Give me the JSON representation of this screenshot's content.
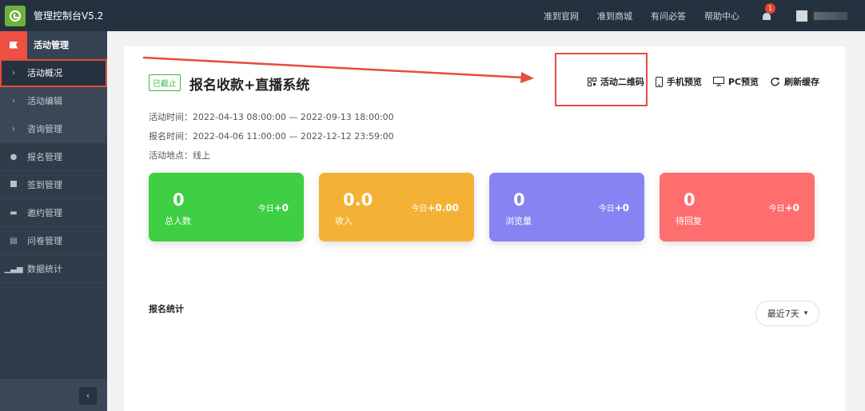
{
  "app": {
    "title": "管理控制台V5.2"
  },
  "top_nav": {
    "links": [
      "准到官网",
      "准到商城",
      "有问必答",
      "帮助中心"
    ],
    "notification_count": "1"
  },
  "sidebar": {
    "section_label": "活动管理",
    "sub_items": [
      "活动概况",
      "活动编辑",
      "咨询管理"
    ],
    "items": [
      "报名管理",
      "签到管理",
      "邀约管理",
      "问卷管理",
      "数据统计"
    ],
    "collapse_glyph": "‹"
  },
  "event": {
    "status": "已截止",
    "title": "报名收款+直播系统",
    "activity_time": "活动时间：2022-04-13 08:00:00 — 2022-09-13 18:00:00",
    "signup_time": "报名时间：2022-04-06 11:00:00 — 2022-12-12 23:59:00",
    "location": "活动地点：线上"
  },
  "actions": {
    "qr_code": "活动二维码",
    "mobile_preview": "手机预览",
    "pc_preview": "PC预览",
    "refresh_cache": "刷新缓存"
  },
  "cards": [
    {
      "value": "0",
      "label": "总人数",
      "today_prefix": "今日",
      "today_value": "+0",
      "color": "#3ecf45"
    },
    {
      "value": "0.0",
      "label": "收入",
      "today_prefix": "今日",
      "today_value": "+0.00",
      "color": "#f3b236"
    },
    {
      "value": "0",
      "label": "浏览量",
      "today_prefix": "今日",
      "today_value": "+0",
      "color": "#8584f2"
    },
    {
      "value": "0",
      "label": "待回复",
      "today_prefix": "今日",
      "today_value": "+0",
      "color": "#ff6e6e"
    }
  ],
  "stats": {
    "title": "报名统计",
    "range_selected": "最近7天"
  }
}
